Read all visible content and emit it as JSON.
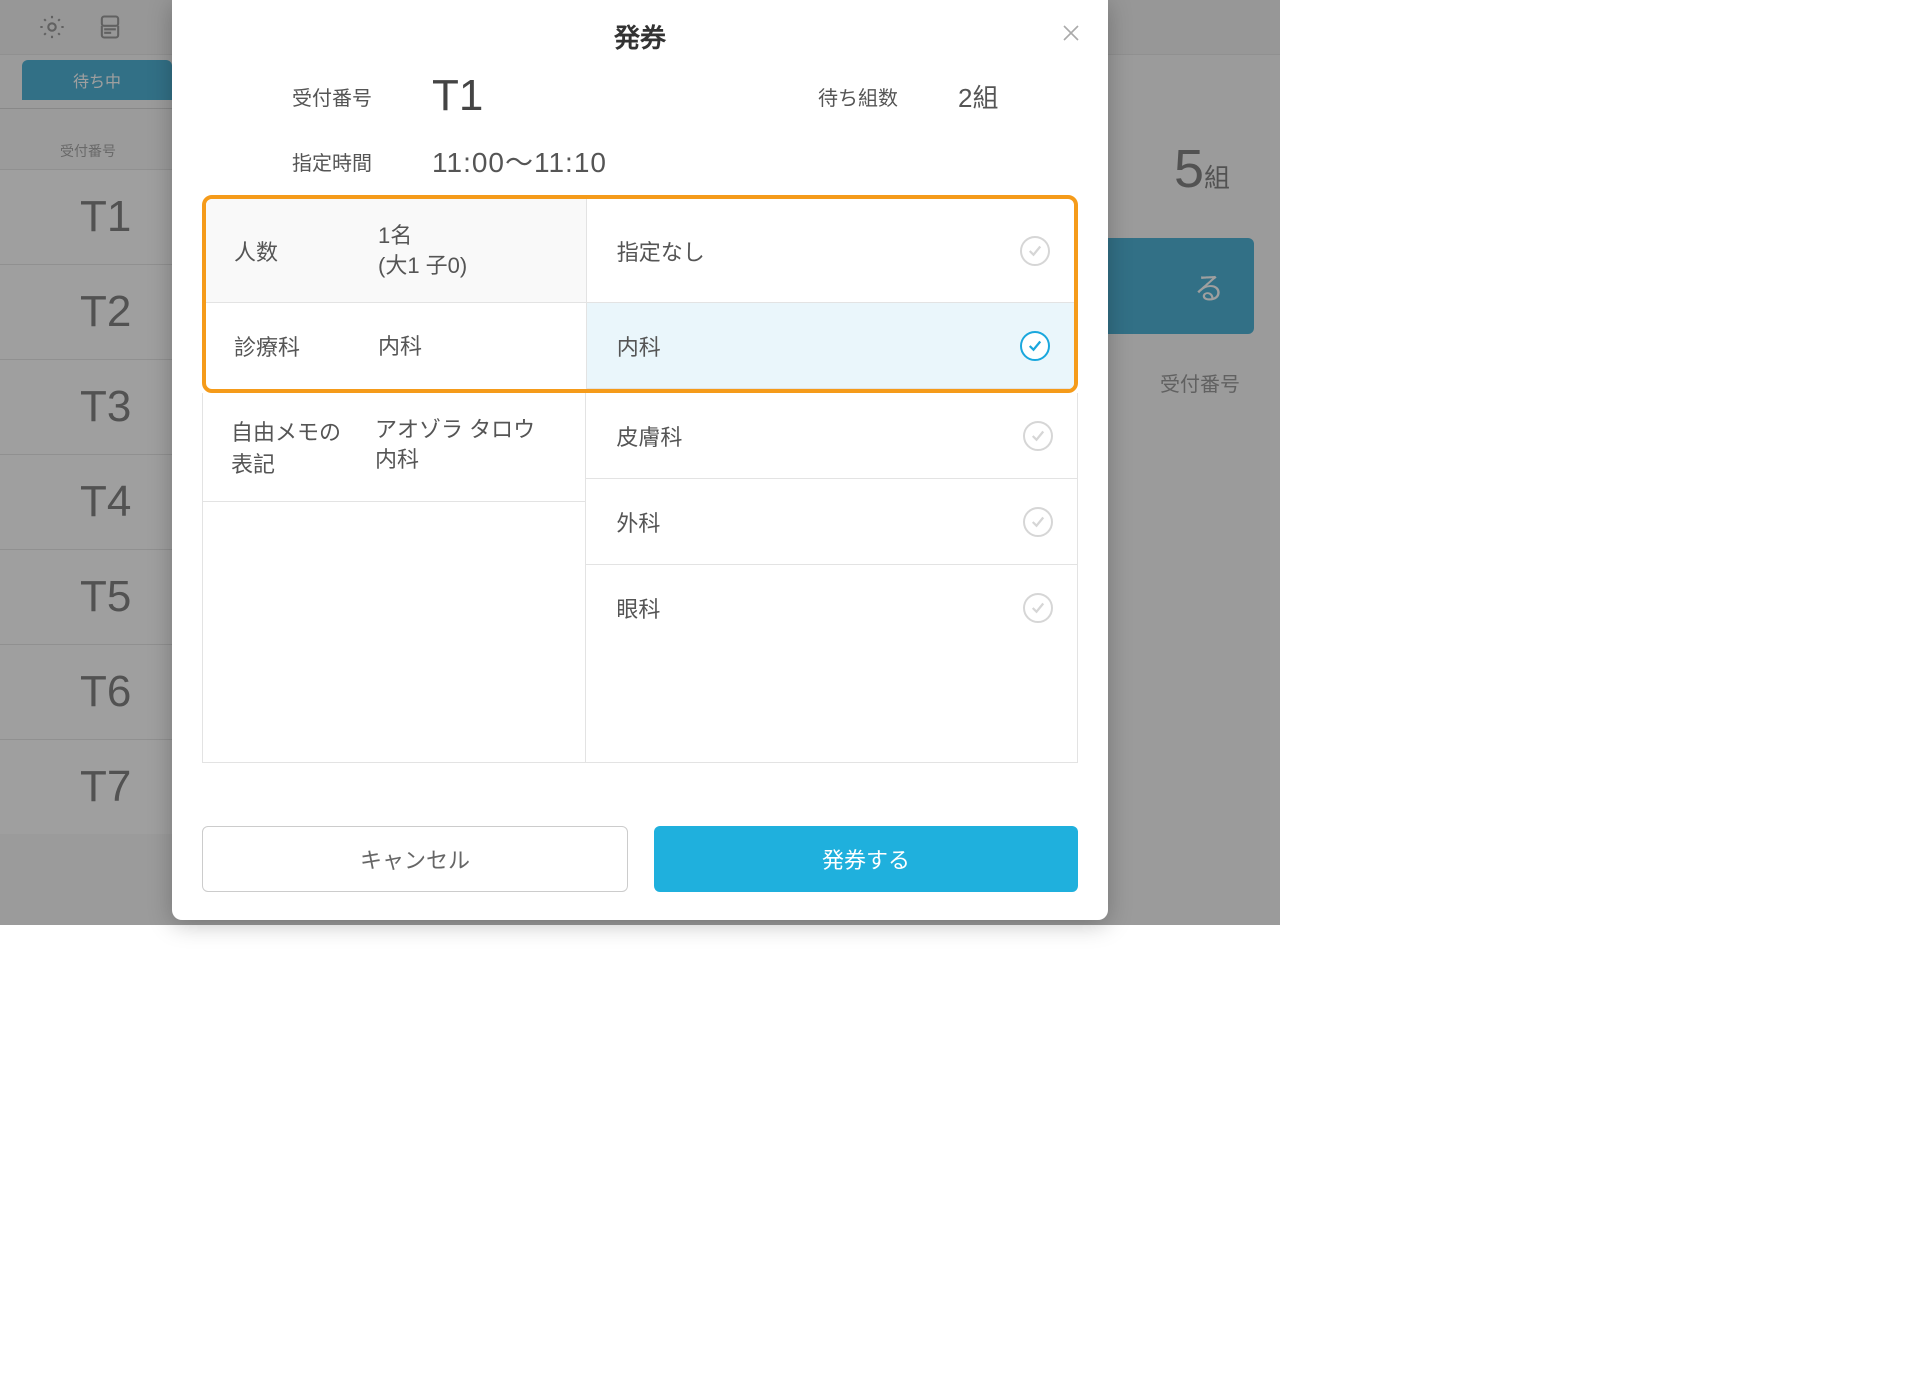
{
  "background": {
    "waiting_tab": "待ち中",
    "list_header": "受付番号",
    "rows": [
      "T1",
      "T2",
      "T3",
      "T4",
      "T5",
      "T6",
      "T7"
    ],
    "group_count_num": "5",
    "group_count_unit": "組",
    "issue_tail": "る",
    "right_label": "受付番号"
  },
  "modal": {
    "title": "発券",
    "summary": {
      "ticket_label": "受付番号",
      "ticket_value": "T1",
      "waiting_label": "待ち組数",
      "waiting_value": "2組",
      "time_label": "指定時間",
      "time_value": "11:00〜11:10"
    },
    "left": {
      "people_label": "人数",
      "people_value_line1": "1名",
      "people_value_line2": "(大1 子0)",
      "dept_label": "診療科",
      "dept_value": "内科",
      "memo_label": "自由メモの表記",
      "memo_value_line1": "アオゾラ タロウ",
      "memo_value_line2": "内科"
    },
    "options": [
      {
        "label": "指定なし",
        "selected": false
      },
      {
        "label": "内科",
        "selected": true
      },
      {
        "label": "皮膚科",
        "selected": false
      },
      {
        "label": "外科",
        "selected": false
      },
      {
        "label": "眼科",
        "selected": false
      }
    ],
    "buttons": {
      "cancel": "キャンセル",
      "submit": "発券する"
    }
  }
}
